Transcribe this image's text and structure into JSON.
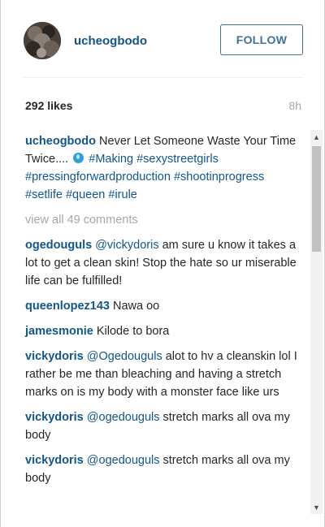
{
  "post": {
    "author": "ucheogbodo",
    "follow_label": "FOLLOW",
    "likes": "292 likes",
    "time": "8h"
  },
  "caption": {
    "user": "ucheogbodo",
    "text_a": "Never Let Someone Waste Your Time Twice....",
    "emoji": "blue-emoji-icon",
    "hashtags_a": "#Making #sexystreetgirls #pressingforwardproduction #shootinprogress #setlife #queen #irule"
  },
  "view_all": "view all 49 comments",
  "comments": [
    {
      "user": "ogedouguls",
      "mention": "@vickydoris",
      "text": "am sure u know it takes a lot to get a clean skin! Stop the hate so ur miserable life can be fulfilled!"
    },
    {
      "user": "queenlopez143",
      "mention": "",
      "text": "Nawa oo"
    },
    {
      "user": "jamesmonie",
      "mention": "",
      "text": "Kilode to bora"
    },
    {
      "user": "vickydoris",
      "mention": "@Ogedouguls",
      "text": "alot to hv a cleanskin lol I rather be me than bleaching and having a stretch marks on is my body with a monster face like urs"
    },
    {
      "user": "vickydoris",
      "mention": "@ogedouguls",
      "text": "stretch marks all ova my body"
    },
    {
      "user": "vickydoris",
      "mention": "@ogedouguls",
      "text": "stretch marks all ova my body"
    }
  ],
  "colors": {
    "username": "#125688",
    "follow": "#3f729b",
    "muted": "#a5a7aa"
  }
}
